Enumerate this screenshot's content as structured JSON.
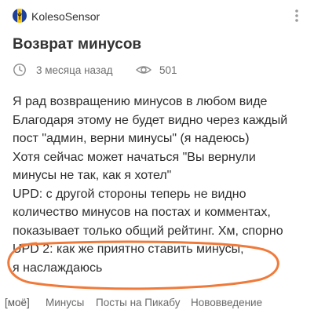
{
  "header": {
    "author": "KolesoSensor",
    "author_icon": "barbados-flag-icon",
    "more_icon": "more-vertical-icon"
  },
  "post": {
    "title": "Возврат минусов",
    "time_ago": "3 месяца назад",
    "views": "501",
    "body_lines": [
      "Я рад возвращению минусов в любом виде",
      "Благодаря этому не будет видно через каждый",
      "пост \"админ, верни минусы\" (я надеюсь)",
      "Хотя сейчас может начаться \"Вы вернули",
      "минусы не так, как я хотел\"",
      "UPD: с другой стороны теперь не видно",
      "количество минусов на постах и комментах,",
      "показывает только общий рейтинг. Хм, спорно",
      "UPD 2: как же приятно ставить минусы,",
      "я наслаждаюсь"
    ]
  },
  "tags": [
    "[моё]",
    "Минусы",
    "Посты на Пикабу",
    "Нововведение"
  ],
  "colors": {
    "highlight_oval": "#f07a3a",
    "meta_text": "#6f6f6f",
    "title_text": "#333333"
  }
}
